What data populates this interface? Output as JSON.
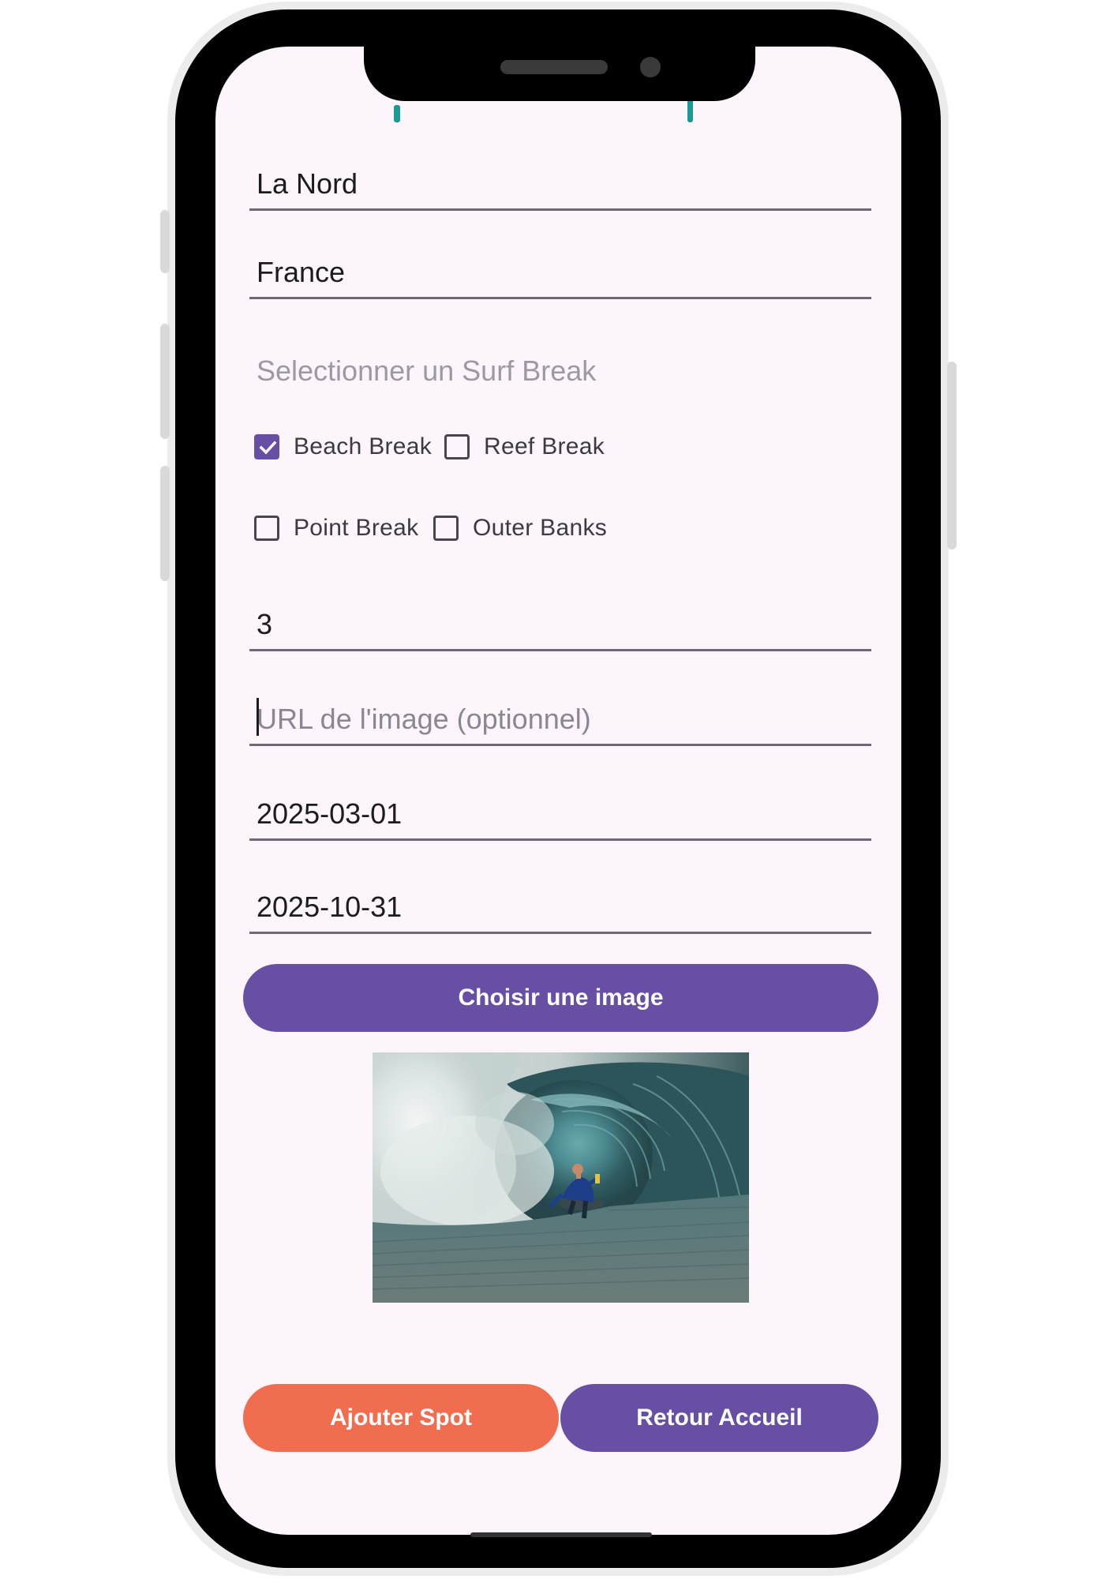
{
  "form": {
    "spot_name": "La Nord",
    "country": "France",
    "surf_break_hint": "Selectionner un Surf Break",
    "surf_breaks": [
      {
        "label": "Beach Break",
        "checked": true
      },
      {
        "label": "Reef Break",
        "checked": false
      },
      {
        "label": "Point Break",
        "checked": false
      },
      {
        "label": "Outer Banks",
        "checked": false
      }
    ],
    "difficulty": "3",
    "image_url_placeholder": "URL de l'image (optionnel)",
    "season_start": "2025-03-01",
    "season_end": "2025-10-31"
  },
  "buttons": {
    "choose_image": "Choisir une image",
    "add_spot": "Ajouter Spot",
    "back_home": "Retour Accueil"
  },
  "colors": {
    "primary": "#6750a4",
    "accent": "#f16d4f",
    "screen_bg": "#fcf5fc",
    "title_teal": "#0c8f8b"
  },
  "preview_image": {
    "icon": "surfer-wave-photo"
  }
}
